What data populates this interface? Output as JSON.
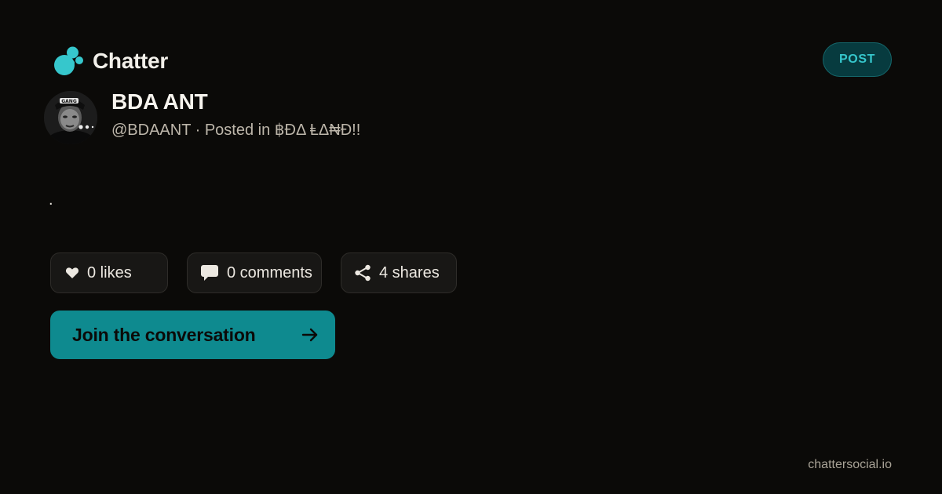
{
  "brand": {
    "name": "Chatter",
    "accent_color": "#36c7cc",
    "logo_icon": "chatter-bubbles-logo-icon"
  },
  "badge": {
    "label": "POST"
  },
  "author": {
    "display_name": "BDA ANT",
    "meta": "@BDAANT · Posted in ฿ĐΔ ⱠΔ₦Đ!!",
    "avatar_icon": "profile-photo"
  },
  "post": {
    "body": "."
  },
  "stats": {
    "likes": "0 likes",
    "likes_icon": "heart-icon",
    "comments": "0 comments",
    "comments_icon": "speech-bubble-icon",
    "shares": "4 shares",
    "shares_icon": "share-icon"
  },
  "cta": {
    "label": "Join the conversation",
    "icon": "arrow-right-icon",
    "color": "#0e8a8f"
  },
  "footer": {
    "domain": "chattersocial.io"
  }
}
